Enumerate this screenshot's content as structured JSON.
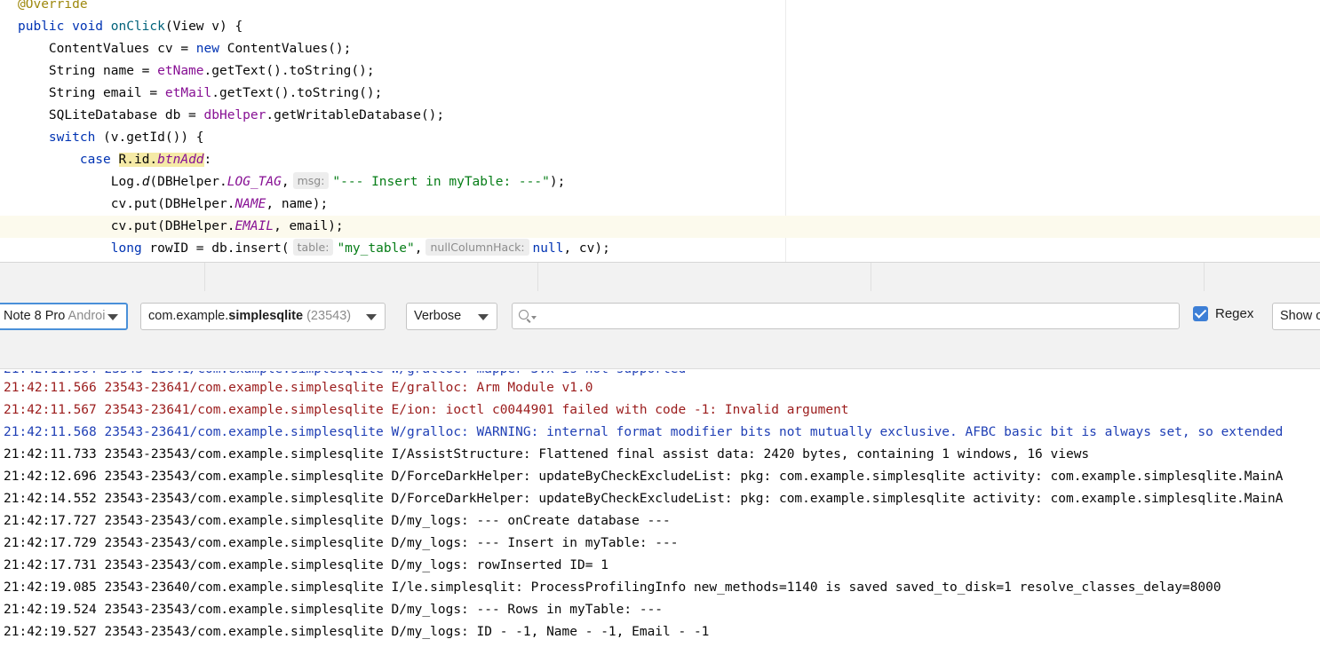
{
  "editor": {
    "lines": [
      {
        "segs": [
          {
            "t": "@Override",
            "c": "ann"
          }
        ]
      },
      {
        "segs": [
          {
            "t": "public void ",
            "c": "kw"
          },
          {
            "t": "onClick",
            "c": "meth"
          },
          {
            "t": "(View v) {",
            "c": ""
          }
        ]
      },
      {
        "segs": [
          {
            "t": "    ContentValues cv = ",
            "c": ""
          },
          {
            "t": "new ",
            "c": "kw"
          },
          {
            "t": "ContentValues();",
            "c": ""
          }
        ]
      },
      {
        "segs": [
          {
            "t": "    String name = ",
            "c": ""
          },
          {
            "t": "etName",
            "c": "fld"
          },
          {
            "t": ".getText().toString();",
            "c": ""
          }
        ]
      },
      {
        "segs": [
          {
            "t": "    String email = ",
            "c": ""
          },
          {
            "t": "etMail",
            "c": "fld"
          },
          {
            "t": ".getText().toString();",
            "c": ""
          }
        ]
      },
      {
        "segs": [
          {
            "t": "    SQLiteDatabase db = ",
            "c": ""
          },
          {
            "t": "dbHelper",
            "c": "fld"
          },
          {
            "t": ".getWritableDatabase();",
            "c": ""
          }
        ]
      },
      {
        "segs": [
          {
            "t": "    ",
            "c": ""
          },
          {
            "t": "switch ",
            "c": "kw"
          },
          {
            "t": "(v.getId()) {",
            "c": ""
          }
        ]
      },
      {
        "segs": [
          {
            "t": "        ",
            "c": ""
          },
          {
            "t": "case ",
            "c": "kw"
          },
          {
            "t": "R.id.",
            "c": "caseref"
          },
          {
            "t": "btnAdd",
            "c": "caseref sfld"
          },
          {
            "t": ":",
            "c": ""
          }
        ]
      },
      {
        "segs": [
          {
            "t": "            Log.",
            "c": ""
          },
          {
            "t": "d",
            "c": "smeth"
          },
          {
            "t": "(DBHelper.",
            "c": ""
          },
          {
            "t": "LOG_TAG",
            "c": "sfld"
          },
          {
            "t": ",",
            "c": ""
          },
          {
            "t": "msg:",
            "c": "hint"
          },
          {
            "t": "\"--- Insert in myTable: ---\"",
            "c": "str"
          },
          {
            "t": ");",
            "c": ""
          }
        ]
      },
      {
        "segs": [
          {
            "t": "            cv.put(DBHelper.",
            "c": ""
          },
          {
            "t": "NAME",
            "c": "sfld"
          },
          {
            "t": ", name);",
            "c": ""
          }
        ]
      },
      {
        "segs": [
          {
            "t": "            cv.put(DBHelper.",
            "c": ""
          },
          {
            "t": "EMAIL",
            "c": "sfld"
          },
          {
            "t": ", email);",
            "c": ""
          }
        ],
        "current": true
      },
      {
        "segs": [
          {
            "t": "            ",
            "c": ""
          },
          {
            "t": "long ",
            "c": "kw"
          },
          {
            "t": "rowID = db.insert(",
            "c": ""
          },
          {
            "t": "table:",
            "c": "hint"
          },
          {
            "t": "\"my_table\"",
            "c": "str"
          },
          {
            "t": ",",
            "c": ""
          },
          {
            "t": "nullColumnHack:",
            "c": "hint"
          },
          {
            "t": "null",
            "c": "kw"
          },
          {
            "t": ", cv);",
            "c": ""
          }
        ]
      }
    ]
  },
  "toolbar": {
    "device": {
      "main": "Note 8 Pro ",
      "dim": "Androi"
    },
    "process": {
      "prefix": "com.example.",
      "bold": "simplesqlite",
      "pid": " (23543)"
    },
    "log_level": "Verbose",
    "search_value": "",
    "regex_checked": true,
    "regex_label": "Regex",
    "show_label": "Show o"
  },
  "log": [
    {
      "text": "21:42:11.566 23543-23641/com.example.simplesqlite E/gralloc: Arm Module v1.0",
      "level": "E"
    },
    {
      "text": "21:42:11.567 23543-23641/com.example.simplesqlite E/ion: ioctl c0044901 failed with code -1: Invalid argument",
      "level": "E"
    },
    {
      "text": "21:42:11.568 23543-23641/com.example.simplesqlite W/gralloc: WARNING: internal format modifier bits not mutually exclusive. AFBC basic bit is always set, so extended",
      "level": "W"
    },
    {
      "text": "21:42:11.733 23543-23543/com.example.simplesqlite I/AssistStructure: Flattened final assist data: 2420 bytes, containing 1 windows, 16 views",
      "level": "I"
    },
    {
      "text": "21:42:12.696 23543-23543/com.example.simplesqlite D/ForceDarkHelper: updateByCheckExcludeList: pkg: com.example.simplesqlite activity: com.example.simplesqlite.MainA",
      "level": "D"
    },
    {
      "text": "21:42:14.552 23543-23543/com.example.simplesqlite D/ForceDarkHelper: updateByCheckExcludeList: pkg: com.example.simplesqlite activity: com.example.simplesqlite.MainA",
      "level": "D"
    },
    {
      "text": "21:42:17.727 23543-23543/com.example.simplesqlite D/my_logs: --- onCreate database ---",
      "level": "D"
    },
    {
      "text": "21:42:17.729 23543-23543/com.example.simplesqlite D/my_logs: --- Insert in myTable: ---",
      "level": "D"
    },
    {
      "text": "21:42:17.731 23543-23543/com.example.simplesqlite D/my_logs: rowInserted ID= 1",
      "level": "D"
    },
    {
      "text": "21:42:19.085 23543-23640/com.example.simplesqlite I/le.simplesqlit: ProcessProfilingInfo new_methods=1140 is saved saved_to_disk=1 resolve_classes_delay=8000",
      "level": "I"
    },
    {
      "text": "21:42:19.524 23543-23543/com.example.simplesqlite D/my_logs: --- Rows in myTable: ---",
      "level": "D"
    },
    {
      "text": "21:42:19.527 23543-23543/com.example.simplesqlite D/my_logs: ID - -1, Name - -1, Email - -1",
      "level": "D"
    }
  ]
}
